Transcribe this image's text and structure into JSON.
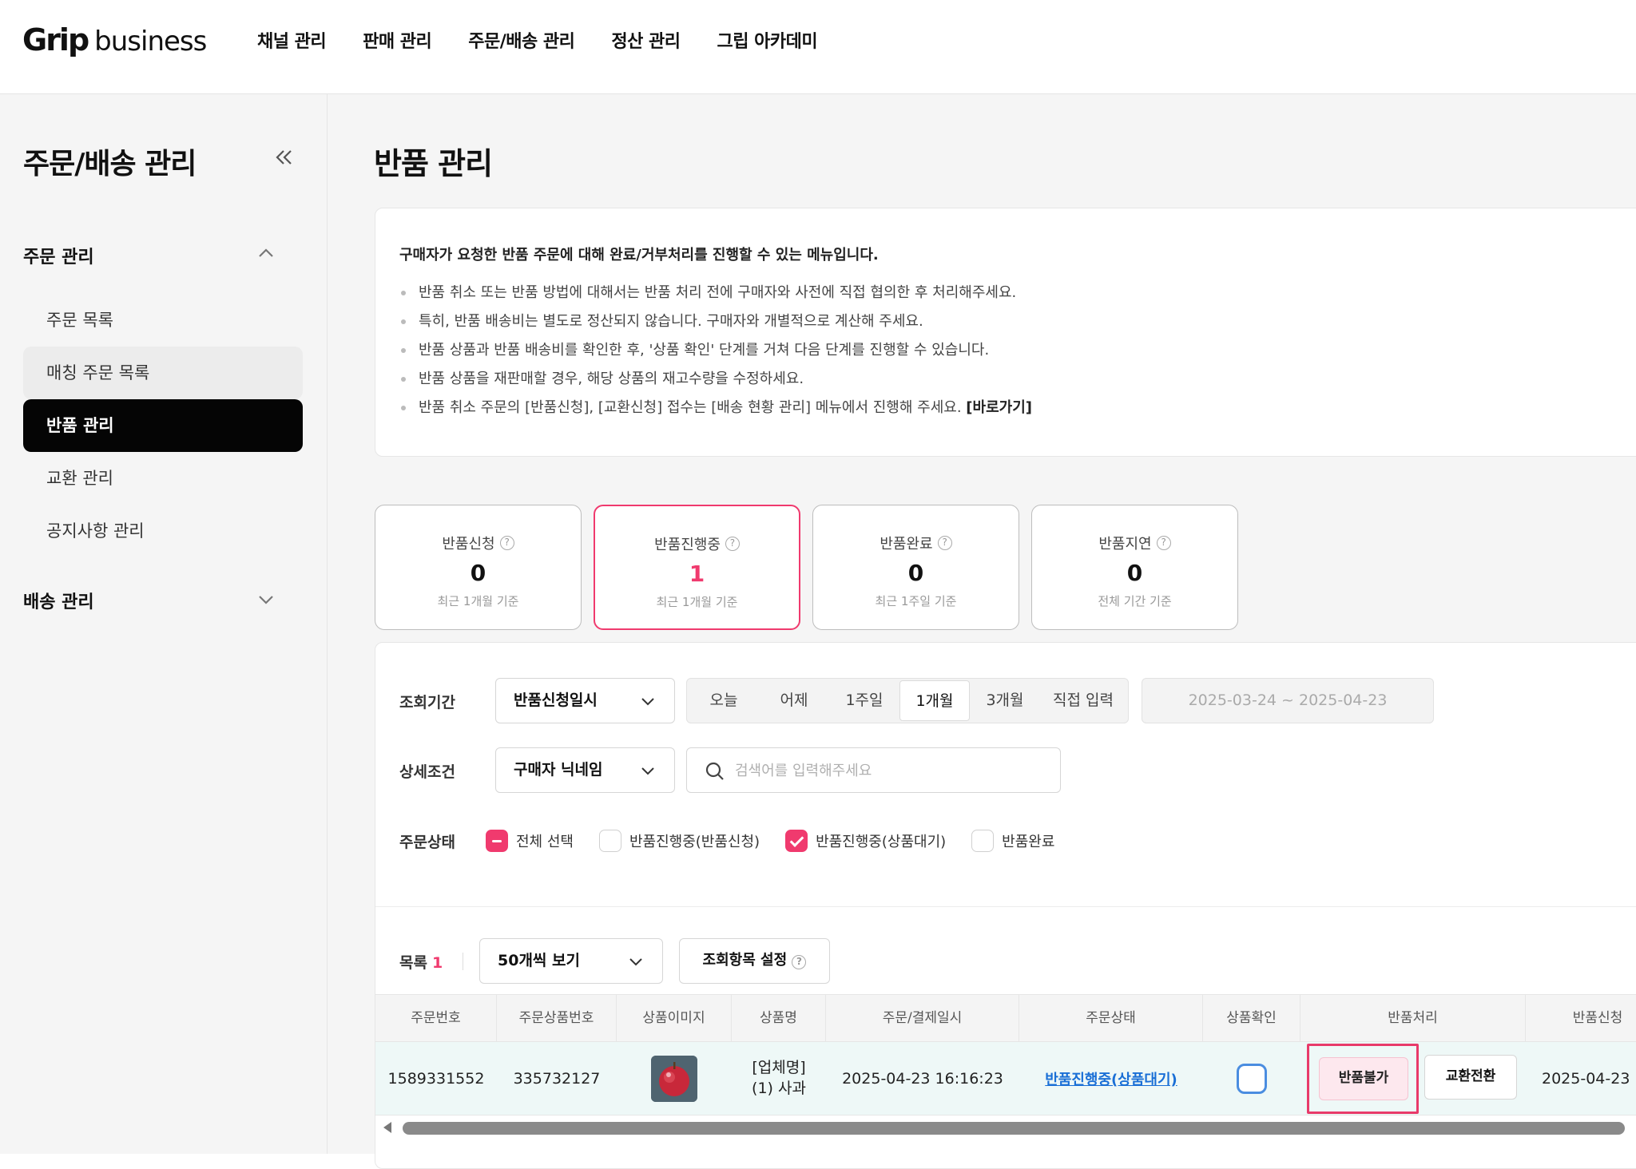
{
  "header": {
    "logo_main": "Grip",
    "logo_sub": "business",
    "nav": [
      "채널 관리",
      "판매 관리",
      "주문/배송 관리",
      "정산 관리",
      "그립 아카데미"
    ]
  },
  "sidebar": {
    "title": "주문/배송 관리",
    "sections": [
      {
        "title": "주문 관리",
        "expanded": true,
        "items": [
          "주문 목록",
          "매칭 주문 목록",
          "반품 관리",
          "교환 관리",
          "공지사항 관리"
        ]
      },
      {
        "title": "배송 관리",
        "expanded": false
      }
    ],
    "active_item": "반품 관리",
    "hover_item": "매칭 주문 목록"
  },
  "page": {
    "title": "반품 관리",
    "info": {
      "heading": "구매자가 요청한 반품 주문에 대해 완료/거부처리를 진행할 수 있는 메뉴입니다.",
      "bullets": [
        "반품 취소 또는 반품 방법에 대해서는 반품 처리 전에 구매자와 사전에 직접 협의한 후 처리해주세요.",
        "특히, 반품 배송비는 별도로 정산되지 않습니다. 구매자와 개별적으로 계산해 주세요.",
        "반품 상품과 반품 배송비를 확인한 후, '상품 확인' 단계를 거쳐 다음 단계를 진행할 수 있습니다.",
        "반품 상품을 재판매할 경우, 해당 상품의 재고수량을 수정하세요."
      ],
      "last_bullet": "반품 취소 주문의 [반품신청], [교환신청] 접수는 [배송 현황 관리] 메뉴에서 진행해 주세요.",
      "shortcut_link": "[바로가기]"
    },
    "stats": [
      {
        "label": "반품신청",
        "value": "0",
        "sub": "최근 1개월 기준",
        "active": false
      },
      {
        "label": "반품진행중",
        "value": "1",
        "sub": "최근 1개월 기준",
        "active": true
      },
      {
        "label": "반품완료",
        "value": "0",
        "sub": "최근 1주일 기준",
        "active": false
      },
      {
        "label": "반품지연",
        "value": "0",
        "sub": "전체 기간 기준",
        "active": false
      }
    ],
    "filter": {
      "period_label": "조회기간",
      "period_type": "반품신청일시",
      "quick_ranges": [
        "오늘",
        "어제",
        "1주일",
        "1개월",
        "3개월",
        "직접 입력"
      ],
      "selected_range": "1개월",
      "date_range": "2025-03-24 ~ 2025-04-23",
      "detail_label": "상세조건",
      "detail_type": "구매자 닉네임",
      "search_placeholder": "검색어를 입력해주세요",
      "status_label": "주문상태",
      "status_options": [
        {
          "label": "전체 선택",
          "state": "indeterminate"
        },
        {
          "label": "반품진행중(반품신청)",
          "state": "unchecked"
        },
        {
          "label": "반품진행중(상품대기)",
          "state": "checked"
        },
        {
          "label": "반품완료",
          "state": "unchecked"
        }
      ]
    },
    "list": {
      "label": "목록",
      "count": "1",
      "page_size": "50개씩 보기",
      "column_settings": "조회항목 설정"
    },
    "table": {
      "headers": [
        "주문번호",
        "주문상품번호",
        "상품이미지",
        "상품명",
        "주문/결제일시",
        "주문상태",
        "상품확인",
        "반품처리",
        "반품신청"
      ],
      "rows": [
        {
          "order_no": "1589331552",
          "item_no": "335732127",
          "image": "apple-photo",
          "name_line1": "[업체명]",
          "name_line2": "(1) 사과",
          "ordered_at": "2025-04-23 16:16:23",
          "status": "반품진행중(상품대기)",
          "checked": false,
          "action_refuse": "반품불가",
          "action_exchange": "교환전환",
          "requested_at": "2025-04-23"
        }
      ]
    }
  },
  "colors": {
    "accent": "#f03a6e",
    "link": "#1a6fd6",
    "row_highlight": "#eef8f7"
  }
}
